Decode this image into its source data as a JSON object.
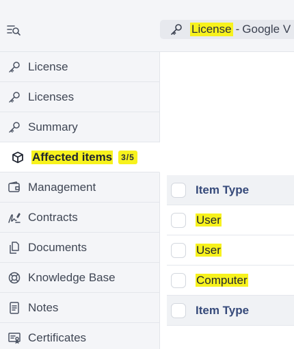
{
  "header": {
    "breadcrumb": {
      "title": "License",
      "separator": "-",
      "subtitle": "Google V"
    }
  },
  "sidebar": {
    "items": [
      {
        "label": "License",
        "icon": "key-icon"
      },
      {
        "label": "Licenses",
        "icon": "key-icon"
      },
      {
        "label": "Summary",
        "icon": "key-icon"
      },
      {
        "label": "Affected items",
        "icon": "box-icon",
        "badge": "3/5",
        "active": true
      },
      {
        "label": "Management",
        "icon": "wallet-icon"
      },
      {
        "label": "Contracts",
        "icon": "signature-icon"
      },
      {
        "label": "Documents",
        "icon": "documents-icon"
      },
      {
        "label": "Knowledge Base",
        "icon": "lifebuoy-icon"
      },
      {
        "label": "Notes",
        "icon": "note-icon"
      },
      {
        "label": "Certificates",
        "icon": "certificate-icon"
      }
    ]
  },
  "table": {
    "column_header": "Item Type",
    "rows": [
      {
        "item_type": "User"
      },
      {
        "item_type": "User"
      },
      {
        "item_type": "Computer"
      }
    ],
    "footer_header": "Item Type"
  },
  "colors": {
    "highlight": "#f7f21d",
    "header_text": "#364a7a",
    "sidebar_bg": "#f4f5f8"
  }
}
